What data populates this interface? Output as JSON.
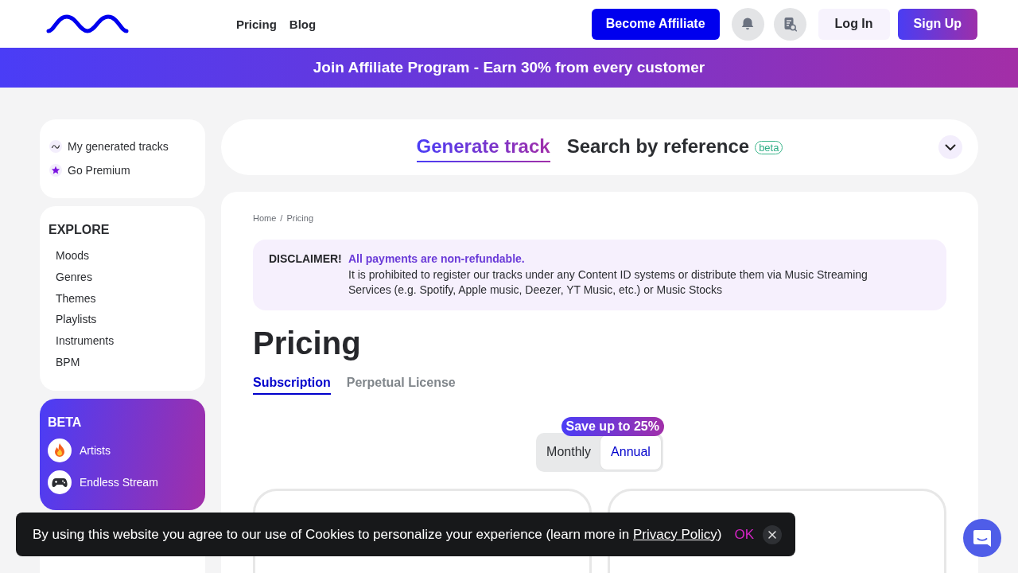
{
  "header": {
    "nav": [
      {
        "label": "Pricing"
      },
      {
        "label": "Blog"
      }
    ],
    "affiliate_button": "Become Affiliate",
    "login_button": "Log In",
    "signup_button": "Sign Up"
  },
  "promo_banner": {
    "text": "Join Affiliate Program - Earn 30% from every customer"
  },
  "sidebar": {
    "quick_links": [
      {
        "label": "My generated tracks",
        "kind": "wave"
      },
      {
        "label": "Go Premium",
        "kind": "star"
      }
    ],
    "explore": {
      "title": "EXPLORE",
      "items": [
        "Moods",
        "Genres",
        "Themes",
        "Playlists",
        "Instruments",
        "BPM"
      ]
    },
    "beta": {
      "title": "BETA",
      "items": [
        {
          "label": "Artists",
          "kind": "fire"
        },
        {
          "label": "Endless Stream",
          "kind": "gamepad"
        }
      ]
    }
  },
  "mode_tabs": [
    {
      "label": "Generate track",
      "selected": true
    },
    {
      "label": "Search by reference",
      "selected": false,
      "badge": "beta"
    }
  ],
  "breadcrumb": {
    "items": [
      "Home",
      "Pricing"
    ],
    "separator": "/"
  },
  "disclaimer": {
    "label": "DISCLAIMER!",
    "headline": "All payments are non-refundable.",
    "text": "It is prohibited to register our tracks under any Content ID systems or distribute them via Music Streaming Services (e.g. Spotify, Apple music, Deezer, YT Music, etc.) or Music Stocks"
  },
  "title": "Pricing",
  "pricing_tabs": [
    {
      "label": "Subscription",
      "selected": true
    },
    {
      "label": "Perpetual License",
      "selected": false
    }
  ],
  "billing_toggle": {
    "badge": "Save up to 25%",
    "options": [
      {
        "label": "Monthly",
        "selected": false
      },
      {
        "label": "Annual",
        "selected": true
      }
    ]
  },
  "cookie_banner": {
    "text": "By using this website you agree to our use of Cookies to personalize your experience (learn more in ",
    "link": "Privacy Policy",
    "text_end": ")",
    "accept": "OK"
  }
}
